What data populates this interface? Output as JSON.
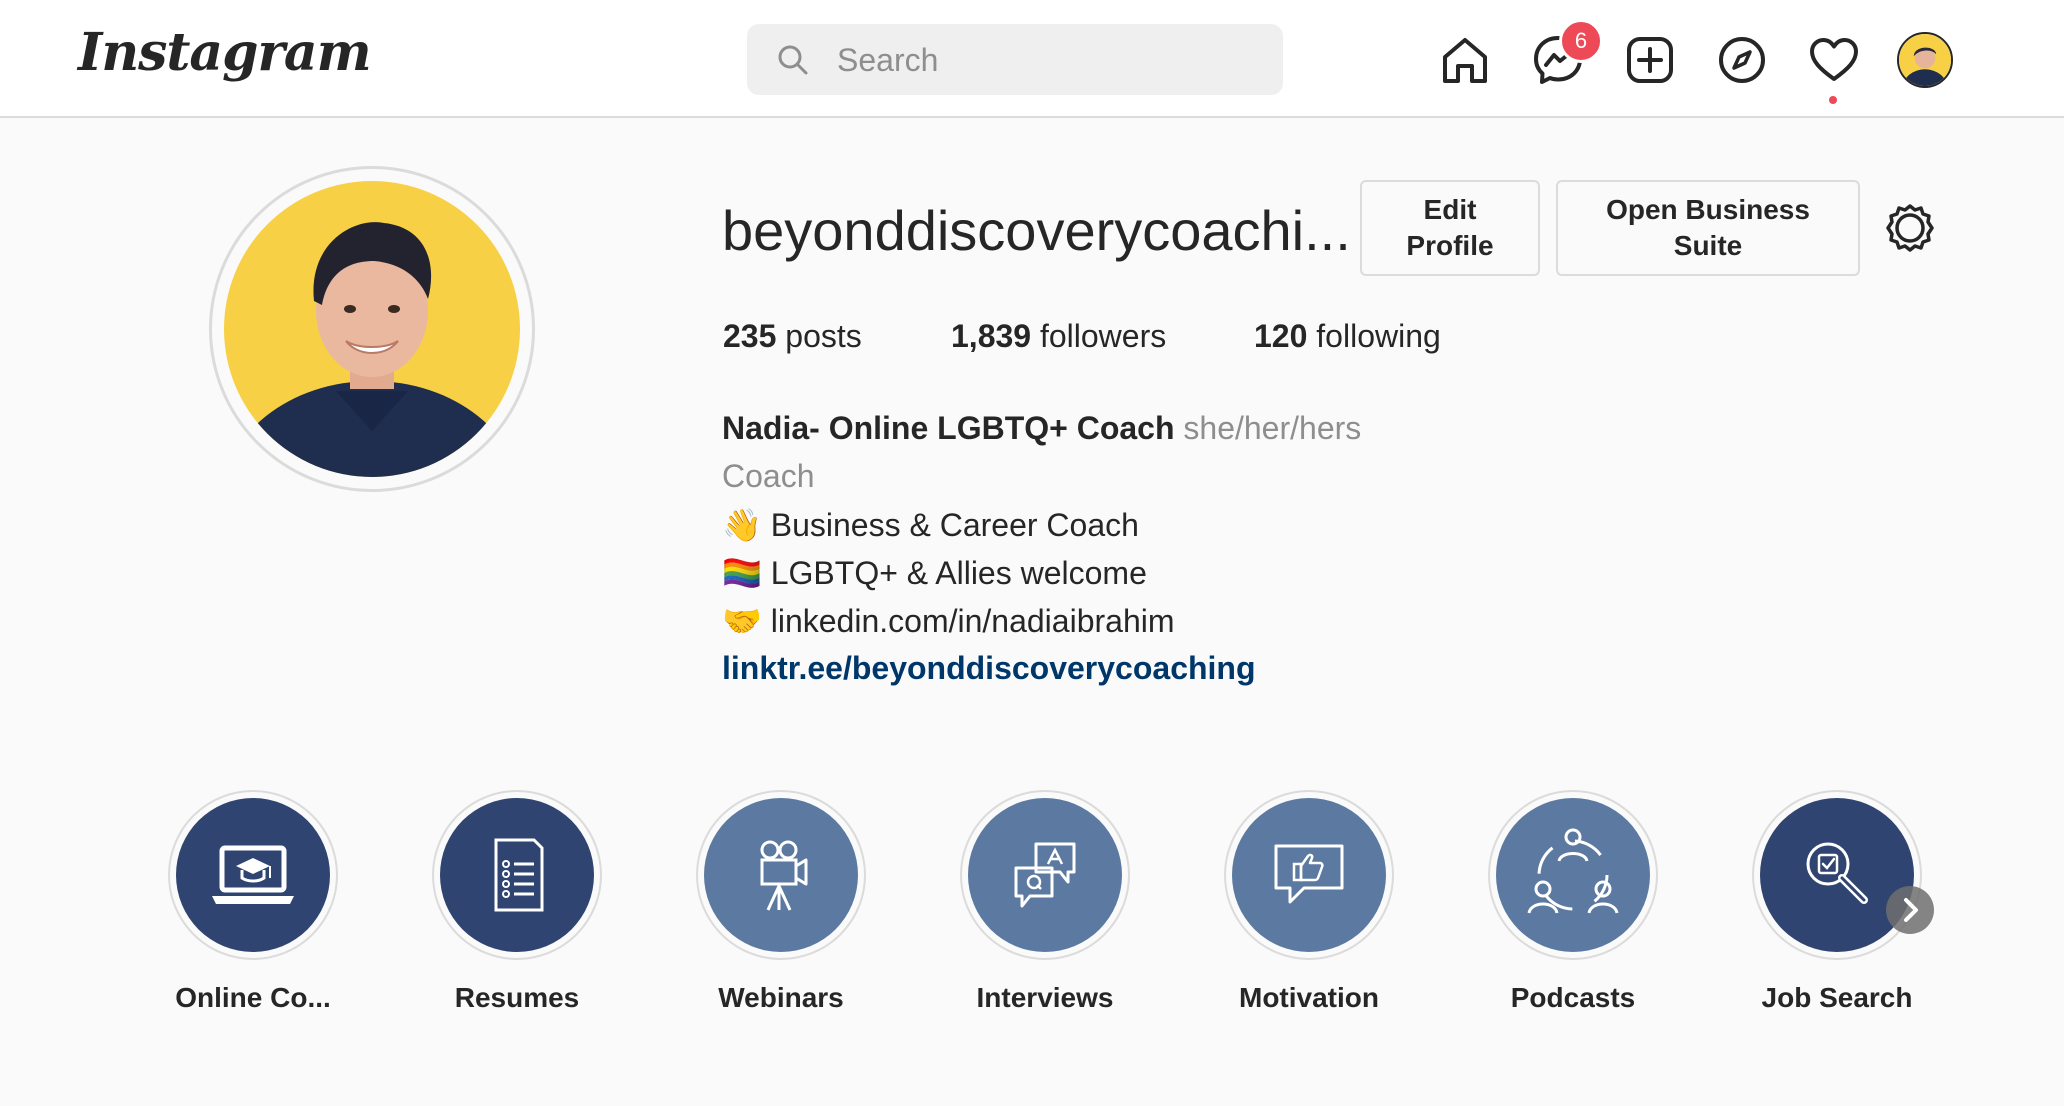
{
  "nav": {
    "logo": "Instagram",
    "search_placeholder": "Search",
    "messages_badge": "6"
  },
  "profile": {
    "username": "beyonddiscoverycoachi...",
    "edit_profile_label": "Edit Profile",
    "business_suite_label": "Open Business Suite",
    "stats": {
      "posts_count": "235",
      "posts_label": "posts",
      "followers_count": "1,839",
      "followers_label": "followers",
      "following_count": "120",
      "following_label": "following"
    },
    "bio": {
      "full_name": "Nadia- Online LGBTQ+ Coach",
      "pronouns": "she/her/hers",
      "category": "Coach",
      "lines": [
        {
          "emoji": "👋",
          "text": "Business & Career Coach"
        },
        {
          "emoji": "🏳️‍🌈",
          "text": "LGBTQ+ & Allies welcome"
        },
        {
          "emoji": "🤝",
          "text": "linkedin.com/in/nadiaibrahim"
        }
      ],
      "website": "linktr.ee/beyonddiscoverycoaching"
    }
  },
  "highlights": [
    {
      "label": "Online Co...",
      "icon": "laptop-graduation-icon",
      "color": "#2f4471"
    },
    {
      "label": "Resumes",
      "icon": "document-list-icon",
      "color": "#2f4471"
    },
    {
      "label": "Webinars",
      "icon": "film-camera-icon",
      "color": "#5c7aa1"
    },
    {
      "label": "Interviews",
      "icon": "qa-chat-icon",
      "color": "#5c7aa1"
    },
    {
      "label": "Motivation",
      "icon": "thumbs-up-chat-icon",
      "color": "#5c7aa1"
    },
    {
      "label": "Podcasts",
      "icon": "people-network-icon",
      "color": "#5c7aa1"
    },
    {
      "label": "Job Search",
      "icon": "search-checklist-icon",
      "color": "#2f4471"
    }
  ],
  "colors": {
    "accent_link": "#00376b",
    "notification_red": "#ed4956",
    "highlight_dark": "#2f4471",
    "highlight_light": "#5c7aa1",
    "avatar_background": "#f7d046"
  }
}
